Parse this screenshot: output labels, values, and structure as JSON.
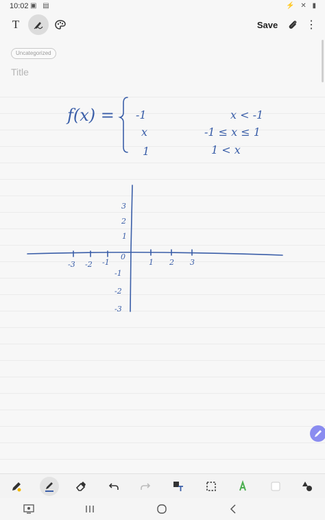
{
  "status_bar": {
    "time": "10:02",
    "left_icons": "▣ ▤",
    "right_icons": "⚡ ✕ ▮"
  },
  "toolbar": {
    "text_tool_label": "T",
    "save_label": "Save",
    "more_label": "⋮"
  },
  "note": {
    "category_tag": "Uncategorized",
    "title_placeholder": "Title"
  },
  "handwriting": {
    "function_label": "f(x) =",
    "piece_values": [
      "-1",
      "x",
      "1"
    ],
    "piece_conditions": [
      "x < -1",
      "-1 ≤ x ≤ 1",
      "1 < x"
    ],
    "y_ticks": [
      "3",
      "2",
      "1",
      "0",
      "-1",
      "-2",
      "-3"
    ],
    "x_ticks_neg": [
      "-3",
      "-2",
      "-1"
    ],
    "x_ticks_pos": [
      "1",
      "2",
      "3"
    ]
  },
  "colors": {
    "ink": "#3a5ea8",
    "fab": "#8a8cf0",
    "highlighter": "#4caf50"
  },
  "icons": {
    "toolbar": [
      "text-icon",
      "pen-mode-icon",
      "palette-icon",
      "attach-icon",
      "more-icon"
    ],
    "bottom_tools": [
      "pen-icon",
      "pen-selected-icon",
      "eraser-icon",
      "undo-icon",
      "redo-icon",
      "image-text-icon",
      "selection-icon",
      "highlighter-icon",
      "shape-icon",
      "shapes-fill-icon"
    ],
    "nav": [
      "screenshot-icon",
      "recents-icon",
      "home-icon",
      "back-icon"
    ]
  }
}
